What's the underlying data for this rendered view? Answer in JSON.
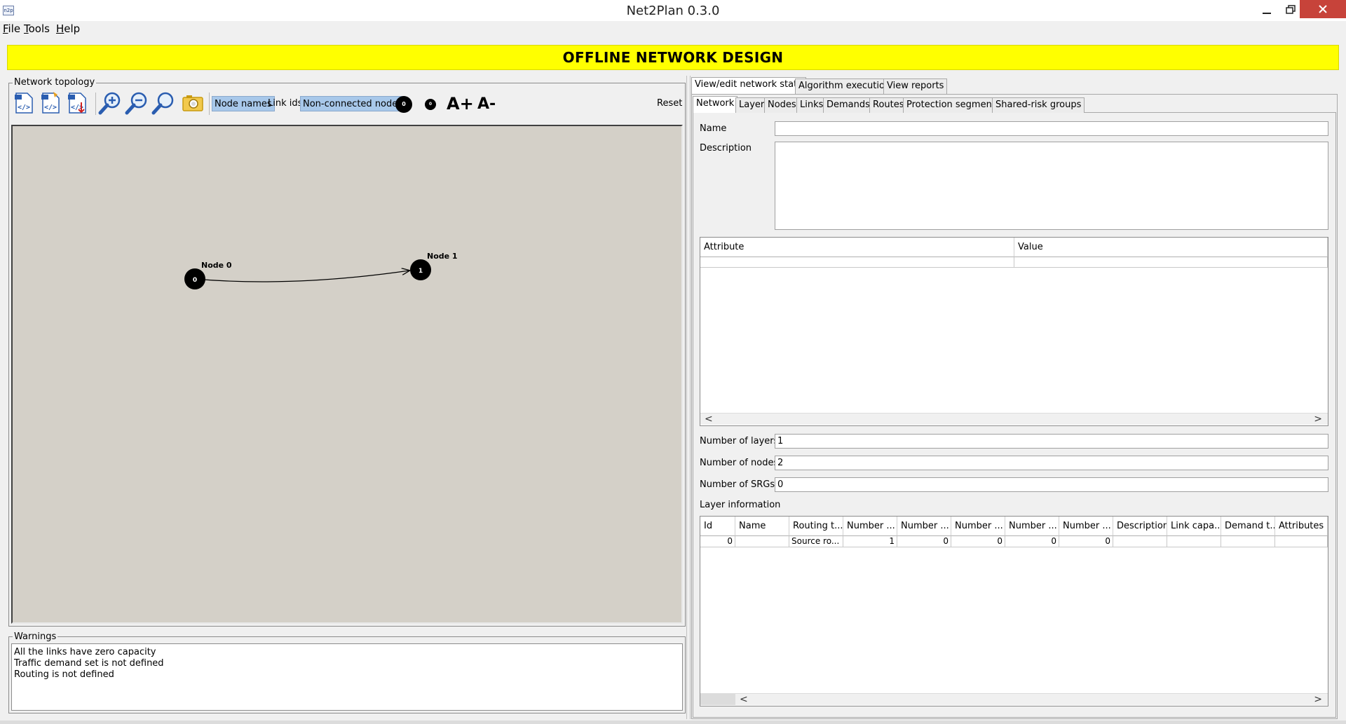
{
  "window": {
    "title": "Net2Plan 0.3.0",
    "app_icon_text": "n2p"
  },
  "menu": {
    "items": [
      {
        "mnemonic": "F",
        "rest": "ile"
      },
      {
        "mnemonic": "T",
        "rest": "ools"
      },
      {
        "mnemonic": "H",
        "rest": "elp"
      }
    ]
  },
  "banner": {
    "text": "OFFLINE NETWORK DESIGN"
  },
  "topology": {
    "group_title": "Network topology",
    "toggles": {
      "node_names": {
        "label": "Node names",
        "active": true
      },
      "link_ids": {
        "label": "Link ids",
        "active": false
      },
      "non_connected_nodes": {
        "label": "Non-connected nodes",
        "active": true
      }
    },
    "node_size_increase_label": "0",
    "node_size_decrease_label": "0",
    "font_increase_label": "A+",
    "font_decrease_label": "A-",
    "reset_label": "Reset",
    "nodes": [
      {
        "id": "0",
        "name": "Node 0"
      },
      {
        "id": "1",
        "name": "Node 1"
      }
    ],
    "canvas_color": "#d4d0c8"
  },
  "warnings": {
    "group_title": "Warnings",
    "lines": [
      "All the links have zero capacity",
      "Traffic demand set is not defined",
      "Routing is not defined"
    ]
  },
  "right": {
    "main_tabs": [
      "View/edit network state",
      "Algorithm execution",
      "View reports"
    ],
    "sub_tabs": [
      "Network",
      "Layer",
      "Nodes",
      "Links",
      "Demands",
      "Routes",
      "Protection segments",
      "Shared-risk groups"
    ],
    "name_label": "Name",
    "name_value": "",
    "description_label": "Description",
    "description_value": "",
    "attr_table": {
      "headers": [
        "Attribute",
        "Value"
      ]
    },
    "num_layers_label": "Number of layers",
    "num_layers_value": "1",
    "num_nodes_label": "Number of nodes",
    "num_nodes_value": "2",
    "num_srgs_label": "Number of SRGs",
    "num_srgs_value": "0",
    "layer_info_label": "Layer information",
    "layer_table": {
      "headers": [
        "Id",
        "Name",
        "Routing t...",
        "Number ...",
        "Number ...",
        "Number ...",
        "Number ...",
        "Number ...",
        "Description",
        "Link capa...",
        "Demand t...",
        "Attributes"
      ],
      "row": [
        "0",
        "",
        "Source ro...",
        "1",
        "0",
        "0",
        "0",
        "0",
        "",
        "",
        "",
        ""
      ]
    }
  },
  "scroll_left_glyph": "<",
  "scroll_right_glyph": ">",
  "colors": {
    "banner": "#ffff00",
    "toggle_active": "#a8c8ea",
    "close_button": "#c7433a"
  }
}
